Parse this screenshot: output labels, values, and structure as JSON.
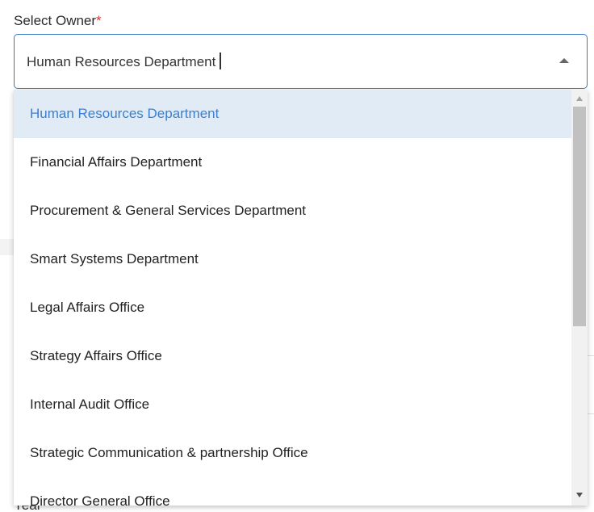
{
  "form": {
    "field_label": "Select Owner",
    "required_marker": "*",
    "selected_value": "Human Resources Department",
    "behind_label": "Year"
  },
  "dropdown": {
    "options": [
      {
        "label": "Human Resources Department",
        "selected": true
      },
      {
        "label": "Financial Affairs Department",
        "selected": false
      },
      {
        "label": "Procurement & General Services Department",
        "selected": false
      },
      {
        "label": "Smart Systems Department",
        "selected": false
      },
      {
        "label": "Legal Affairs Office",
        "selected": false
      },
      {
        "label": "Strategy Affairs Office",
        "selected": false
      },
      {
        "label": "Internal Audit Office",
        "selected": false
      },
      {
        "label": "Strategic Communication & partnership Office",
        "selected": false
      },
      {
        "label": "Director General Office",
        "selected": false
      }
    ]
  },
  "colors": {
    "accent": "#3b78c2",
    "selected_text": "#3b7fd0",
    "selected_bg": "#e1ebf6",
    "required": "#e0342f"
  }
}
